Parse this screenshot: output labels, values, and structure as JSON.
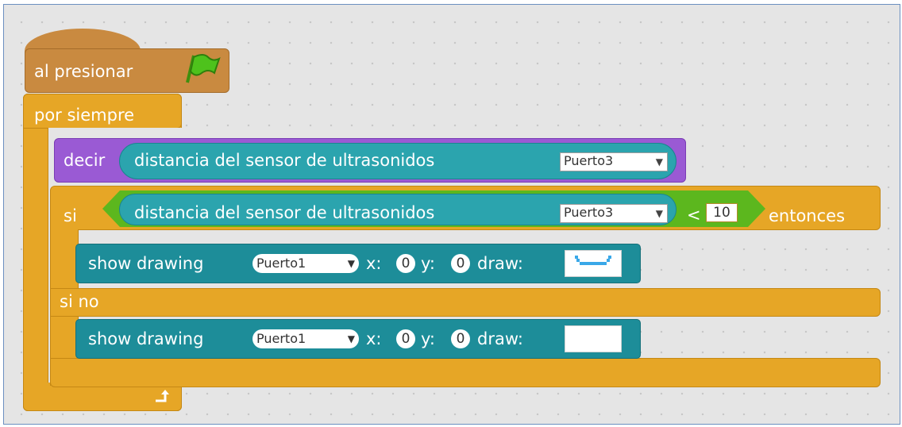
{
  "hat": {
    "label": "al presionar",
    "icon": "green-flag-icon"
  },
  "forever": {
    "label": "por siempre",
    "icon": "loop-arrow-icon"
  },
  "say": {
    "label": "decir",
    "reporter": "distancia del sensor de ultrasonidos",
    "port": "Puerto3"
  },
  "if_else": {
    "if_label": "si",
    "then_label": "entonces",
    "else_label": "si no",
    "condition": {
      "reporter": "distancia del sensor de ultrasonidos",
      "port": "Puerto3",
      "operator": "<",
      "value": "10"
    }
  },
  "show_then": {
    "label": "show drawing",
    "port": "Puerto1",
    "x_label": "x:",
    "x": "0",
    "y_label": "y:",
    "y": "0",
    "draw_label": "draw:",
    "drawing": "smile-face"
  },
  "show_else": {
    "label": "show drawing",
    "port": "Puerto1",
    "x_label": "x:",
    "x": "0",
    "y_label": "y:",
    "y": "0",
    "draw_label": "draw:",
    "drawing": "blank"
  },
  "colors": {
    "canvas": "#e5e5e5",
    "control": "#e6a626",
    "hat": "#c98a40",
    "looks": "#9a5ad4",
    "sensor": "#2ba4ae",
    "action": "#1d8d99",
    "operator": "#5cb71e",
    "matrix_led": "#3aa8e8"
  }
}
